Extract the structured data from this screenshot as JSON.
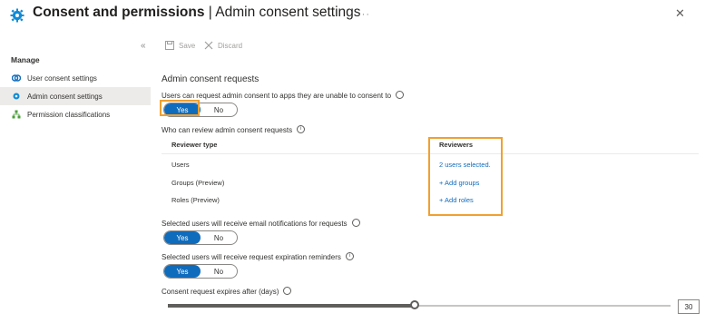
{
  "header": {
    "title_main": "Consent and permissions",
    "title_sep": " | ",
    "title_sub": "Admin consent settings",
    "more": "···",
    "close": "✕"
  },
  "sidebar": {
    "collapse": "«",
    "manage_label": "Manage",
    "items": [
      {
        "label": "User consent settings",
        "icon": "consent-icon",
        "active": false
      },
      {
        "label": "Admin consent settings",
        "icon": "gear-icon",
        "active": true
      },
      {
        "label": "Permission classifications",
        "icon": "classification-icon",
        "active": false
      }
    ]
  },
  "toolbar": {
    "save_label": "Save",
    "discard_label": "Discard"
  },
  "main": {
    "section_title": "Admin consent requests",
    "q1": {
      "label": "Users can request admin consent to apps they are unable to consent to",
      "yes": "Yes",
      "no": "No",
      "selected": "Yes"
    },
    "q2": {
      "label": "Who can review admin consent requests"
    },
    "table": {
      "col_type": "Reviewer type",
      "col_reviewers": "Reviewers",
      "rows": [
        {
          "type": "Users",
          "value": "2 users selected."
        },
        {
          "type": "Groups (Preview)",
          "value": "+ Add groups"
        },
        {
          "type": "Roles (Preview)",
          "value": "+ Add roles"
        }
      ]
    },
    "q3": {
      "label": "Selected users will receive email notifications for requests",
      "yes": "Yes",
      "no": "No",
      "selected": "Yes"
    },
    "q4": {
      "label": "Selected users will receive request expiration reminders",
      "yes": "Yes",
      "no": "No",
      "selected": "Yes"
    },
    "q5": {
      "label": "Consent request expires after (days)",
      "value": "30"
    }
  },
  "colors": {
    "accent": "#0f6cbd",
    "highlight": "#f0a030"
  }
}
